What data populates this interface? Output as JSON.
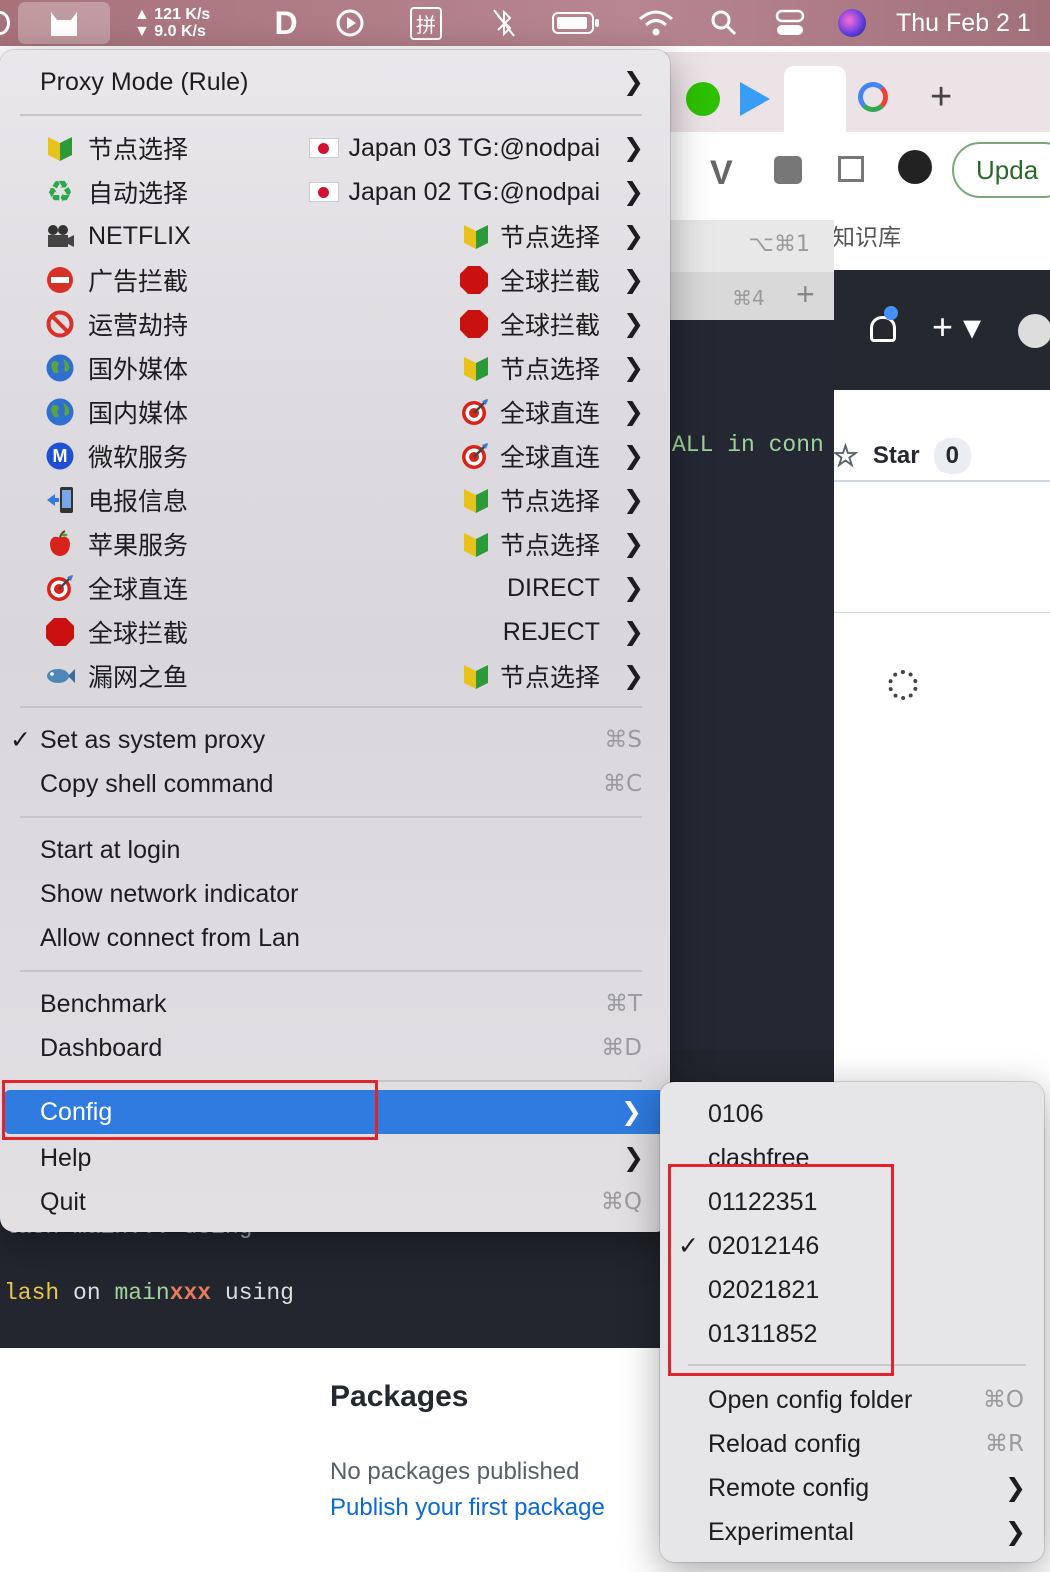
{
  "menubar": {
    "net_up": "▲ 121  K/s",
    "net_down": "▼ 9.0  K/s",
    "input_method": "拼",
    "clock": "Thu Feb 2  1"
  },
  "background": {
    "terminal_hint_1": "⌥⌘1",
    "terminal_hint_2": "⌘4",
    "terminal_line_1": "ALL in conn",
    "terminal_line_2_a": "lash",
    "terminal_line_2_b": "on",
    "terminal_line_2_c": "main",
    "terminal_line_2_d": "xxx",
    "terminal_line_2_e": "using",
    "terminal_partial": "lash   main...  using",
    "browser_update_label": "Upda",
    "bookmark_label": "知识库",
    "star_label": "Star",
    "star_count": "0",
    "packages_title": "Packages",
    "packages_empty": "No packages published",
    "packages_link": "Publish your first package"
  },
  "menu": {
    "proxy_mode": "Proxy Mode (Rule)",
    "proxies": [
      {
        "icon": "beginner-badge-icon",
        "label": "节点选择",
        "value_icon": "japan-flag-icon",
        "value": "Japan 03 TG:@nodpai"
      },
      {
        "icon": "recycle-icon",
        "label": "自动选择",
        "value_icon": "japan-flag-icon",
        "value": "Japan 02 TG:@nodpai"
      },
      {
        "icon": "movie-camera-icon",
        "label": "NETFLIX",
        "value_icon": "beginner-badge-icon",
        "value": "节点选择"
      },
      {
        "icon": "no-entry-icon",
        "label": "广告拦截",
        "value_icon": "stop-sign-icon",
        "value": "全球拦截"
      },
      {
        "icon": "prohibited-icon",
        "label": "运营劫持",
        "value_icon": "stop-sign-icon",
        "value": "全球拦截"
      },
      {
        "icon": "globe-icon",
        "label": "国外媒体",
        "value_icon": "beginner-badge-icon",
        "value": "节点选择"
      },
      {
        "icon": "globe-icon",
        "label": "国内媒体",
        "value_icon": "target-icon",
        "value": "全球直连"
      },
      {
        "icon": "metro-m-icon",
        "label": "微软服务",
        "value_icon": "target-icon",
        "value": "全球直连"
      },
      {
        "icon": "phone-arrow-icon",
        "label": "电报信息",
        "value_icon": "beginner-badge-icon",
        "value": "节点选择"
      },
      {
        "icon": "apple-icon",
        "label": "苹果服务",
        "value_icon": "beginner-badge-icon",
        "value": "节点选择"
      },
      {
        "icon": "target-icon",
        "label": "全球直连",
        "value_icon": "",
        "value": "DIRECT"
      },
      {
        "icon": "stop-sign-icon",
        "label": "全球拦截",
        "value_icon": "",
        "value": "REJECT"
      },
      {
        "icon": "fish-icon",
        "label": "漏网之鱼",
        "value_icon": "beginner-badge-icon",
        "value": "节点选择"
      }
    ],
    "set_system_proxy": "Set as system proxy",
    "set_system_proxy_shortcut": "⌘S",
    "copy_shell": "Copy shell command",
    "copy_shell_shortcut": "⌘C",
    "start_at_login": "Start at login",
    "show_network_indicator": "Show network indicator",
    "allow_lan": "Allow connect from Lan",
    "benchmark": "Benchmark",
    "benchmark_shortcut": "⌘T",
    "dashboard": "Dashboard",
    "dashboard_shortcut": "⌘D",
    "config": "Config",
    "help": "Help",
    "quit": "Quit",
    "quit_shortcut": "⌘Q"
  },
  "config_submenu": {
    "items": [
      "0106",
      "clashfree",
      "01122351",
      "02012146",
      "02021821",
      "01311852"
    ],
    "checked_item": "02012146",
    "open_folder": "Open config folder",
    "open_folder_shortcut": "⌘O",
    "reload": "Reload config",
    "reload_shortcut": "⌘R",
    "remote": "Remote config",
    "experimental": "Experimental"
  },
  "colors": {
    "highlight": "#2f7be0",
    "annotation_box": "#e1232b",
    "menubar": "#b07a84"
  }
}
